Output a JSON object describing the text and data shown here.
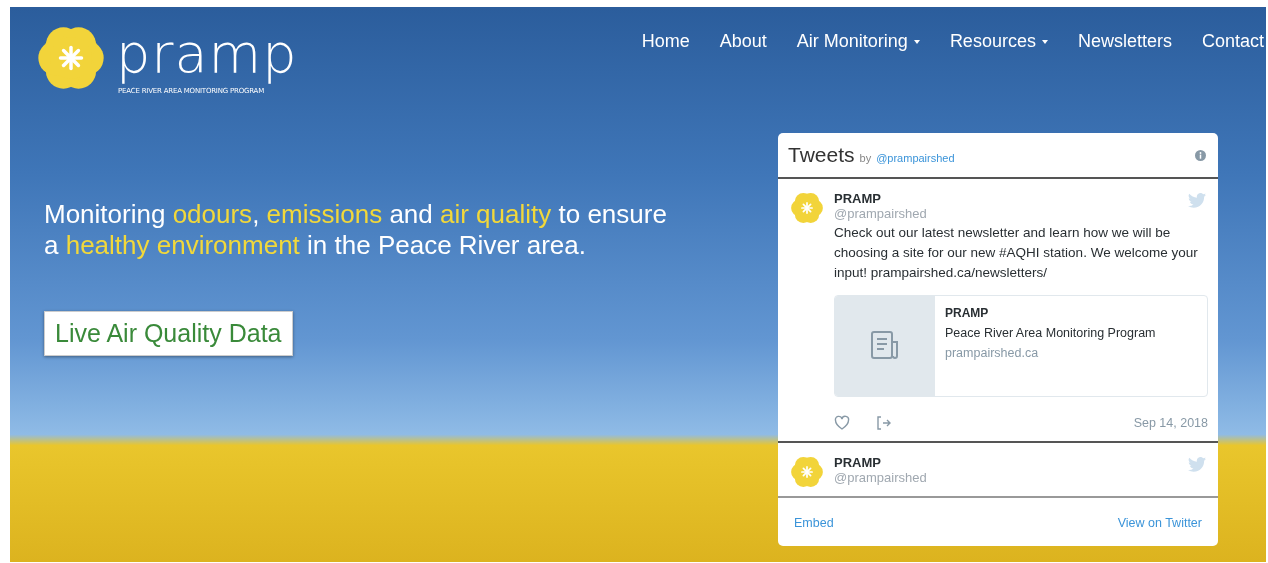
{
  "logo": {
    "wordmark": "pramp",
    "tagline": "PEACE RIVER AREA MONITORING PROGRAM"
  },
  "nav": [
    {
      "label": "Home",
      "has_menu": false
    },
    {
      "label": "About",
      "has_menu": false
    },
    {
      "label": "Air Monitoring",
      "has_menu": true
    },
    {
      "label": "Resources",
      "has_menu": true
    },
    {
      "label": "Newsletters",
      "has_menu": false
    },
    {
      "label": "Contact",
      "has_menu": false
    }
  ],
  "hero": {
    "headline": "Monitoring **odours**, **emissions** and **air quality** to ensure a **healthy environment** in the Peace River area.",
    "cta": "Live Air Quality Data"
  },
  "twitter_widget": {
    "title": "Tweets",
    "by": "by",
    "handle": "@prampairshed",
    "tweets": [
      {
        "name": "PRAMP",
        "handle": "@prampairshed",
        "text": "Check out our latest newsletter and learn how we will be choosing a site for our new #AQHI station. We welcome your input! prampairshed.ca/newsletters/",
        "card": {
          "title": "PRAMP",
          "description": "Peace River Area Monitoring Program",
          "domain": "prampairshed.ca"
        },
        "date": "Sep 14, 2018"
      },
      {
        "name": "PRAMP",
        "handle": "@prampairshed"
      }
    ],
    "footer": {
      "embed": "Embed",
      "view": "View on Twitter"
    }
  }
}
